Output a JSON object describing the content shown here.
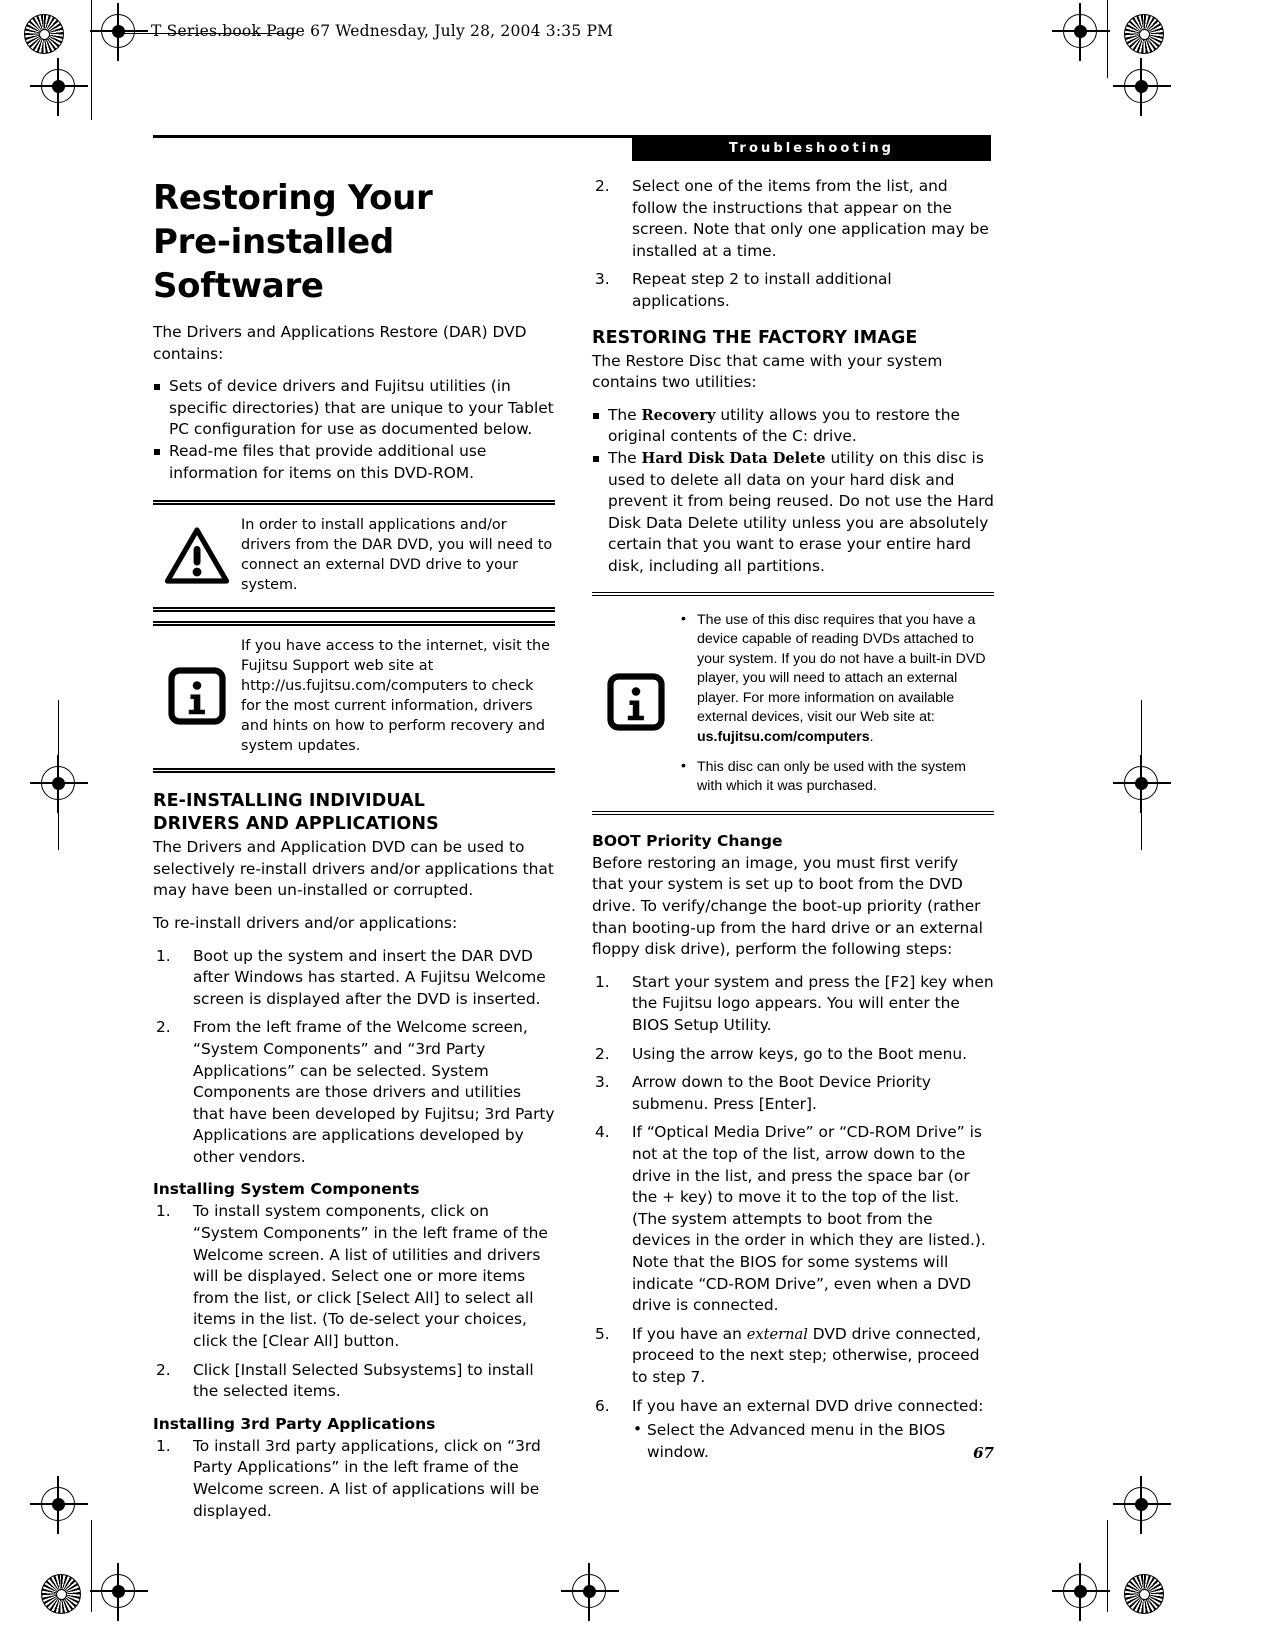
{
  "running_head": "T Series.book  Page 67  Wednesday, July 28, 2004  3:35 PM",
  "chapter_tab": "Troubleshooting",
  "folio": "67",
  "left_column": {
    "title": "Restoring Your\nPre-installed Software",
    "title_line1": "Restoring Your",
    "title_line2": "Pre-installed Software",
    "intro": "The Drivers and Applications Restore (DAR) DVD contains:",
    "bullets": [
      "Sets of device drivers and Fujitsu utilities (in specific directories) that are unique to your Tablet PC configuration for use as documented below.",
      "Read-me files that provide additional use information for items on this DVD-ROM."
    ],
    "caution_note": {
      "icon": "warning-triangle-icon",
      "text": "In order to install applications and/or drivers from the DAR DVD, you will need to connect an external DVD drive to your system."
    },
    "info_note": {
      "icon": "information-icon",
      "text": "If you have access to the internet, visit the Fujitsu Support web site at http://us.fujitsu.com/computers to check for the most current information, drivers and hints on how to perform recovery and system updates."
    },
    "section_heading_line1": "RE-INSTALLING INDIVIDUAL",
    "section_heading_line2": "DRIVERS AND APPLICATIONS",
    "section_para": "The Drivers and Application DVD can be used to selectively re-install drivers and/or applications that may have been un-installed or corrupted.",
    "section_lead": "To re-install drivers and/or applications:",
    "steps": [
      "Boot up the system and insert the DAR DVD after Windows has started. A Fujitsu Welcome screen is displayed after the DVD is inserted.",
      "From the left frame of the Welcome screen, “System Components” and “3rd Party Applications” can be selected. System Components are those drivers and utilities that have been developed by Fujitsu; 3rd Party Applications are applications developed by other vendors."
    ],
    "sub1_heading": "Installing System Components",
    "sub1_steps": [
      "To install system components, click on “System Components” in the left frame of the Welcome screen. A list of utilities and drivers will be displayed. Select one or more items from the list, or click [Select All] to select all items in the list. (To de-select your choices, click the [Clear All] button.",
      "Click [Install Selected Subsystems] to install the selected items."
    ],
    "sub2_heading": "Installing 3rd Party Applications",
    "sub2_steps": [
      "To install 3rd party applications, click on “3rd Party Applications” in the left frame of the Welcome screen. A list of applications will be displayed."
    ]
  },
  "right_column": {
    "cont_steps": [
      "Select one of the items from the list, and follow the instructions that appear on the screen. Note that only one application may be installed at a time.",
      "Repeat step 2 to install additional applications."
    ],
    "cont_steps_start": 2,
    "factory_heading": "RESTORING THE FACTORY IMAGE",
    "factory_para": "The Restore Disc that came with your system contains two utilities:",
    "factory_bullets": [
      {
        "pre": "The ",
        "emph": "Recovery",
        "post": " utility allows you to restore the original contents of the C: drive."
      },
      {
        "pre": "The ",
        "emph": "Hard Disk Data Delete",
        "post": " utility on this disc is used to delete all data on your hard disk and prevent it from being reused. Do not use the Hard Disk Data Delete utility unless you are absolutely certain that you want to erase your entire hard disk, including all partitions."
      }
    ],
    "info_note": {
      "icon": "information-icon",
      "bullets": [
        {
          "text": "The use of this disc requires that you have a device capable of reading DVDs attached to your system. If you do not have a built-in DVD player, you will need to attach an external player. For more information on available external devices, visit our Web site at: ",
          "bold": "us.fujitsu.com/computers",
          "tail": "."
        },
        {
          "text": "This disc can only be used with the system with which it was purchased.",
          "bold": "",
          "tail": ""
        }
      ]
    },
    "boot_heading": "BOOT Priority Change",
    "boot_para": "Before restoring an image, you must first verify that your system is set up to boot from the DVD drive. To verify/change the boot-up priority (rather than booting-up from the hard drive or an external floppy disk drive), perform the following steps:",
    "boot_steps": [
      {
        "text": "Start your system and press the [F2] key when the Fujitsu logo appears. You will enter the BIOS Setup Utility."
      },
      {
        "text": "Using the arrow keys, go to the Boot menu."
      },
      {
        "text": "Arrow down to the Boot Device Priority submenu. Press [Enter]."
      },
      {
        "text": "If “Optical Media Drive” or “CD-ROM Drive” is not at the top of the list, arrow down to the drive in the list, and press the space bar (or the + key) to move it to the top of the list. (The system attempts to boot from the devices in the order in which they are listed.). Note that the BIOS for some systems will indicate “CD-ROM Drive”, even when a DVD drive is connected."
      },
      {
        "pre": "If you have an ",
        "emph": "external",
        "post": " DVD drive connected, proceed to the next step; otherwise, proceed to step 7."
      },
      {
        "text": "If you have an external DVD drive connected:",
        "sub": [
          "Select the Advanced menu in the BIOS window."
        ]
      }
    ]
  }
}
